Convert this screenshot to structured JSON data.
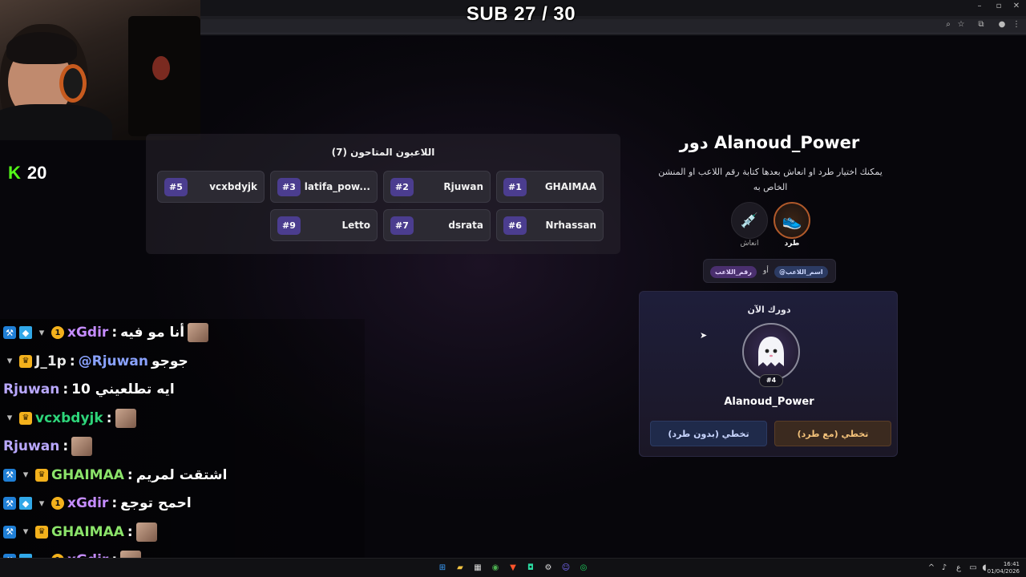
{
  "overlay": {
    "sub_counter": "SUB 27 / 30",
    "kick_logo": "K",
    "kick_viewers": "20"
  },
  "players_panel": {
    "title": "اللاعبون المتاحون (7)",
    "players": [
      {
        "num": "#1",
        "name": "GHAIMAA"
      },
      {
        "num": "#2",
        "name": "Rjuwan"
      },
      {
        "num": "#3",
        "name": "latifa_pow..."
      },
      {
        "num": "#5",
        "name": "vcxbdyjk"
      },
      {
        "num": "#6",
        "name": "Nrhassan"
      },
      {
        "num": "#7",
        "name": "dsrata"
      },
      {
        "num": "#9",
        "name": "Letto"
      }
    ]
  },
  "turn_panel": {
    "title": "دور Alanoud_Power",
    "description": "يمكنك اختيار طرد او انعاش بعدها كتابة رقم اللاعب او المنشن الخاص به",
    "modes": [
      {
        "label": "طرد",
        "icon": "sneaker-icon",
        "selected": true
      },
      {
        "label": "انعاش",
        "icon": "syringe-icon",
        "selected": false
      }
    ],
    "mention_hint": {
      "pill_mention": "@اسم_اللاعب",
      "or_text": "أو",
      "pill_number": "رقم_اللاعب"
    },
    "now_card": {
      "label": "دورك الآن",
      "player_num": "#4",
      "player_name": "Alanoud_Power",
      "skip_with_kick": "تخطي (مع طرد)",
      "skip_without_kick": "تخطي (بدون طرد)"
    }
  },
  "chat": {
    "messages": [
      {
        "user": "xGdir",
        "color": "#c58cff",
        "text": "أنا مو فيه",
        "badges": [
          "blue",
          "cube",
          "cup",
          "coin"
        ],
        "emote": true
      },
      {
        "user": "J_1p",
        "color": "#e8e8e8",
        "text": "جوجو",
        "mention": "@Rjuwan",
        "badges": [
          "cup",
          "crown"
        ],
        "emote": false
      },
      {
        "user": "Rjuwan",
        "color": "#b9a8ff",
        "text": "ايه تطلعيني 10",
        "badges": [],
        "emote": false
      },
      {
        "user": "vcxbdyjk",
        "color": "#2ed47a",
        "text": "",
        "badges": [
          "cup",
          "crown"
        ],
        "emote": true
      },
      {
        "user": "Rjuwan",
        "color": "#b9a8ff",
        "text": "",
        "badges": [],
        "emote": true
      },
      {
        "user": "GHAIMAA",
        "color": "#8be36a",
        "text": "اشتقت لمريم",
        "badges": [
          "blue",
          "cup",
          "crown"
        ],
        "emote": false
      },
      {
        "user": "xGdir",
        "color": "#c58cff",
        "text": "احمح توجع",
        "badges": [
          "blue",
          "cube",
          "cup",
          "coin"
        ],
        "emote": false
      },
      {
        "user": "GHAIMAA",
        "color": "#8be36a",
        "text": "",
        "badges": [
          "blue",
          "cup",
          "crown"
        ],
        "emote": true
      },
      {
        "user": "xGdir",
        "color": "#c58cff",
        "text": "",
        "badges": [
          "blue",
          "cube",
          "cup",
          "coin"
        ],
        "emote": true
      }
    ]
  },
  "taskbar": {
    "lang": "ع",
    "time": "16:41",
    "date": "01/04/2026"
  },
  "colors": {
    "accent": "#4b3d8f",
    "kick_green": "#53fc18",
    "skip_kick": "#3a2a1e",
    "skip_nokick": "#1f2a4a"
  }
}
